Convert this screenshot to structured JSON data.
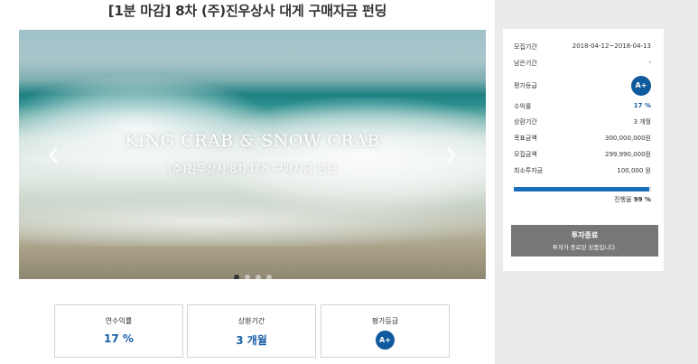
{
  "page": {
    "title": "[1분 마감] 8차 (주)진우상사 대게 구매자금 펀딩"
  },
  "hero": {
    "title": "KING CRAB & SNOW CRAB",
    "subtitle": "(주)진우상사 8차 대게 구매자금 펀딩",
    "prev_icon": "chevron-left-icon",
    "next_icon": "chevron-right-icon",
    "slide_count": 4,
    "active_slide": 1
  },
  "info_boxes": [
    {
      "label": "연수익률",
      "value": "17 %"
    },
    {
      "label": "상환기간",
      "value": "3 개월"
    },
    {
      "label": "평가등급",
      "value": "A+"
    }
  ],
  "side": {
    "rows": [
      {
        "key": "모집기간",
        "value": "2018-04-12~2018-04-13"
      },
      {
        "key": "남은기간",
        "value": "-"
      },
      {
        "key": "평가등급",
        "value": "A+"
      },
      {
        "key": "수익률",
        "value": "17 %"
      },
      {
        "key": "상환기간",
        "value": "3 개월"
      },
      {
        "key": "목표금액",
        "value": "300,000,000원"
      },
      {
        "key": "모집금액",
        "value": "299,990,000원"
      },
      {
        "key": "최소투자금",
        "value": "100,000 원"
      }
    ],
    "progress_percent": 99,
    "progress_label": "진행율",
    "progress_value": "99 %",
    "closed_title": "투자종료",
    "closed_subtitle": "투자가 종료된 상품입니다."
  },
  "colors": {
    "accent": "#1a5fa8",
    "badge": "#0e5a9c",
    "progress": "#1a6fbd",
    "closed_button": "#777777"
  }
}
